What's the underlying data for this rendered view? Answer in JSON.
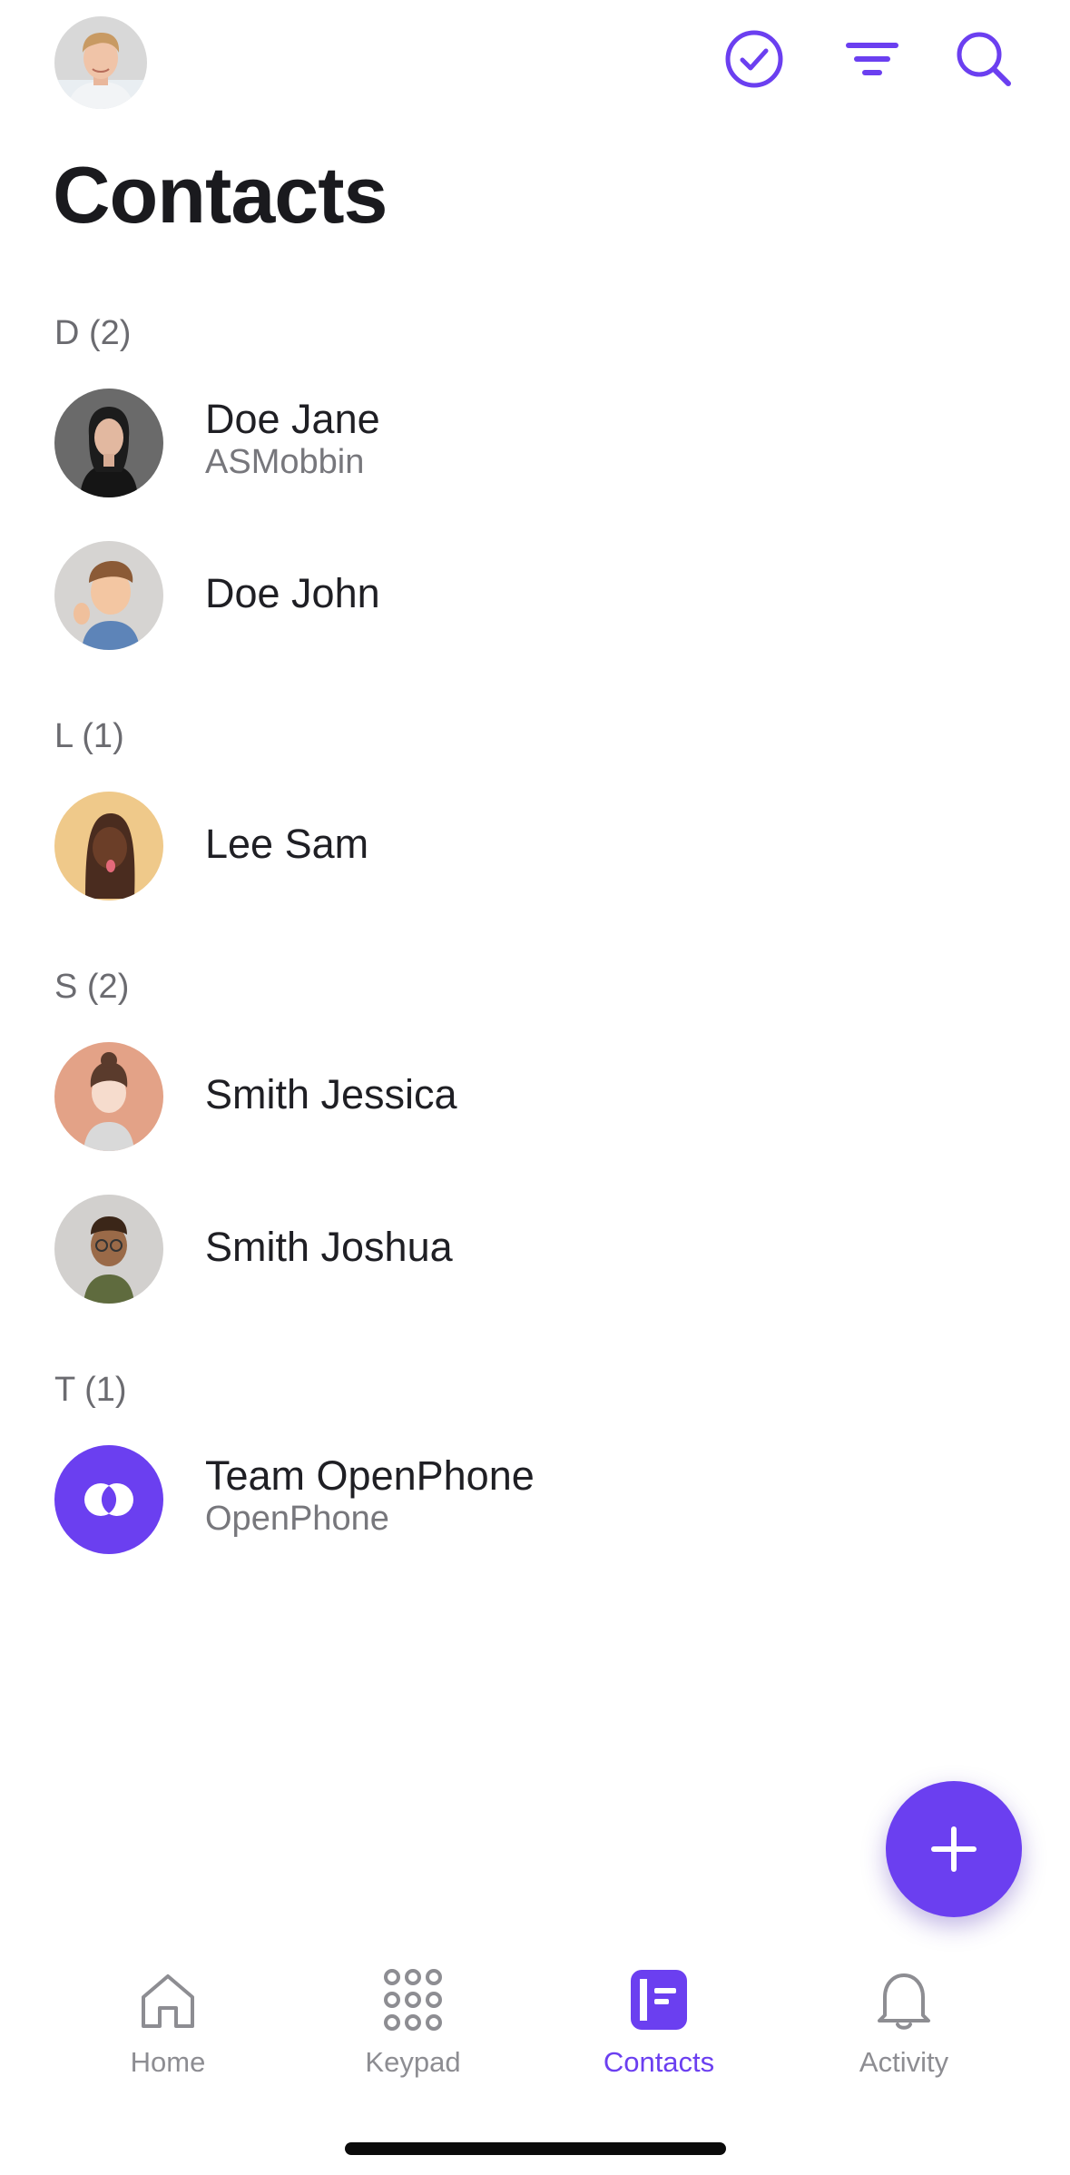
{
  "header": {
    "title": "Contacts",
    "profile_icon": "user-avatar",
    "actions": [
      {
        "icon": "check-circle-icon"
      },
      {
        "icon": "filter-icon"
      },
      {
        "icon": "search-icon"
      }
    ]
  },
  "sections": [
    {
      "letter": "D (2)",
      "contacts": [
        {
          "name": "Doe Jane",
          "subtitle": "ASMobbin"
        },
        {
          "name": "Doe John",
          "subtitle": ""
        }
      ]
    },
    {
      "letter": "L (1)",
      "contacts": [
        {
          "name": "Lee Sam",
          "subtitle": ""
        }
      ]
    },
    {
      "letter": "S (2)",
      "contacts": [
        {
          "name": "Smith Jessica",
          "subtitle": ""
        },
        {
          "name": "Smith Joshua",
          "subtitle": ""
        }
      ]
    },
    {
      "letter": "T (1)",
      "contacts": [
        {
          "name": "Team OpenPhone",
          "subtitle": "OpenPhone"
        }
      ]
    }
  ],
  "fab": {
    "icon": "plus-icon"
  },
  "tabs": [
    {
      "label": "Home",
      "icon": "home-icon",
      "active": false
    },
    {
      "label": "Keypad",
      "icon": "keypad-icon",
      "active": false
    },
    {
      "label": "Contacts",
      "icon": "contacts-book-icon",
      "active": true
    },
    {
      "label": "Activity",
      "icon": "bell-icon",
      "active": false
    }
  ],
  "colors": {
    "accent": "#6b3ff0",
    "text": "#1f1f24",
    "secondary_text": "#77777c",
    "tab_inactive": "#8d8d92"
  }
}
